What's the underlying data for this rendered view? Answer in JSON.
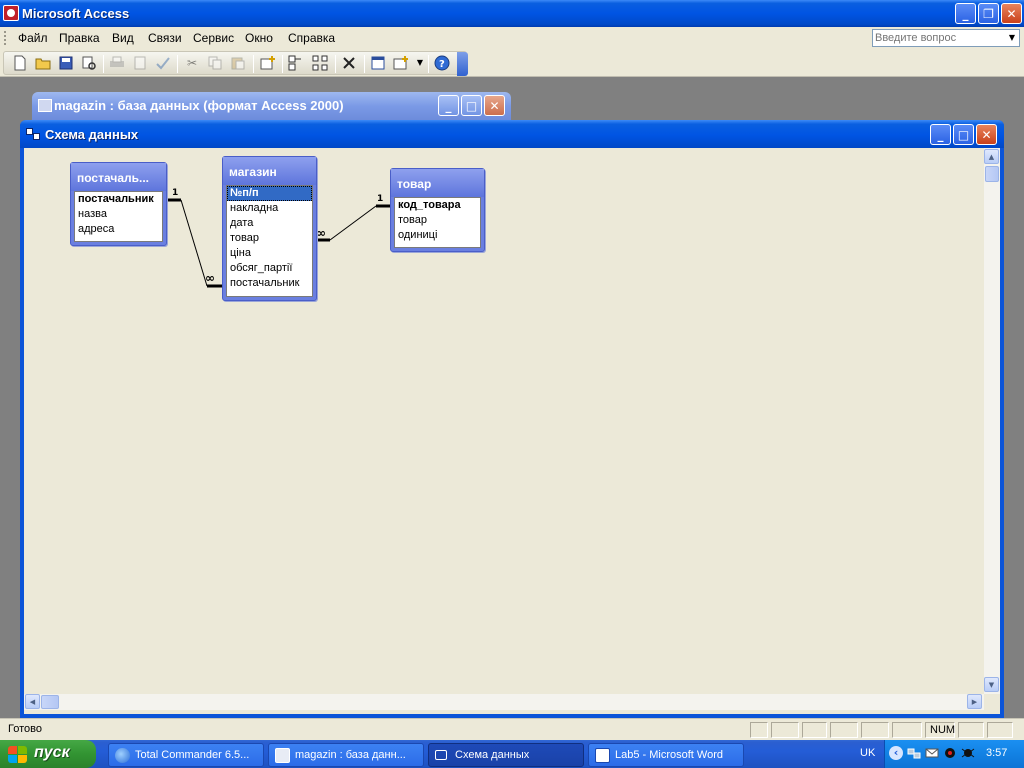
{
  "app": {
    "title": "Microsoft Access",
    "minimize": "_",
    "maximize": "❐",
    "close": "✕"
  },
  "menu": {
    "items": [
      {
        "label": "Файл"
      },
      {
        "label": "Правка"
      },
      {
        "label": "Вид"
      },
      {
        "label": "Связи"
      },
      {
        "label": "Сервис"
      },
      {
        "label": "Окно"
      },
      {
        "label": "Справка"
      }
    ],
    "help_placeholder": "Введите вопрос"
  },
  "db_window": {
    "title": "magazin : база данных (формат Access 2000)"
  },
  "schema_window": {
    "title": "Схема данных",
    "tables": [
      {
        "name": "постачаль...",
        "fields": [
          {
            "label": "постачальник",
            "key": true
          },
          {
            "label": "назва"
          },
          {
            "label": "адреса"
          }
        ]
      },
      {
        "name": "магазин",
        "fields": [
          {
            "label": "№п/п",
            "key": true,
            "selected": true
          },
          {
            "label": "накладна"
          },
          {
            "label": "дата"
          },
          {
            "label": "товар"
          },
          {
            "label": "ціна"
          },
          {
            "label": "обсяг_партії"
          },
          {
            "label": "постачальник"
          }
        ]
      },
      {
        "name": "товар",
        "fields": [
          {
            "label": "код_товара",
            "key": true
          },
          {
            "label": "товар"
          },
          {
            "label": "одиниці"
          }
        ]
      }
    ],
    "relations": [
      {
        "from_label": "1",
        "to_label": "∞"
      },
      {
        "from_label": "1",
        "to_label": "∞"
      }
    ]
  },
  "status": {
    "text": "Готово",
    "num": "NUM"
  },
  "taskbar": {
    "start": "пуск",
    "buttons": [
      {
        "label": "Total Commander 6.5..."
      },
      {
        "label": "magazin : база данн..."
      },
      {
        "label": "Схема данных"
      },
      {
        "label": "Lab5 - Microsoft Word"
      }
    ],
    "lang": "UK",
    "clock": "3:57"
  }
}
